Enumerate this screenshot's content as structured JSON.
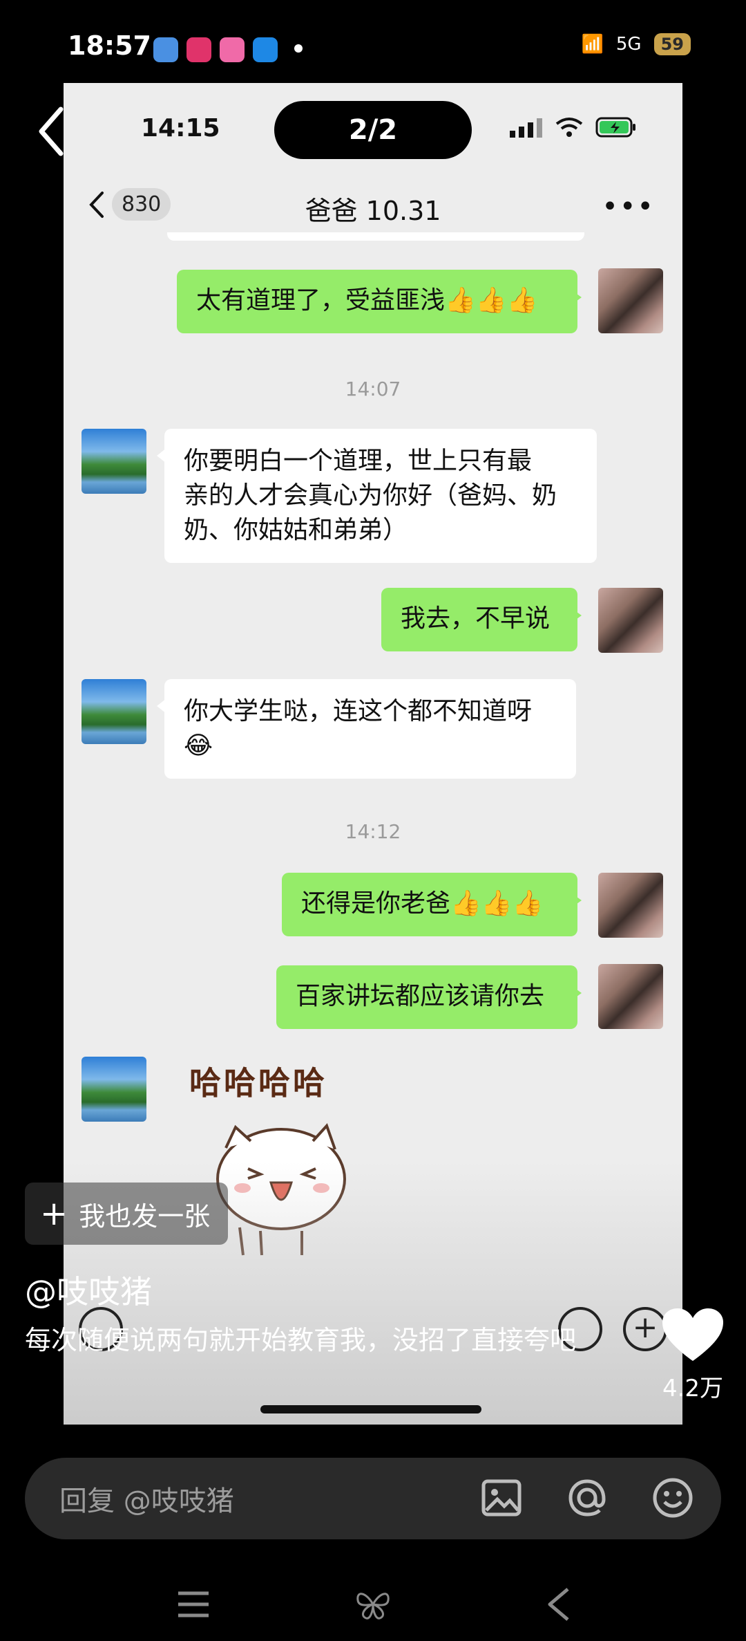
{
  "os_status": {
    "time": "18:57",
    "network": "5G",
    "battery": "59"
  },
  "screenshot": {
    "time": "14:15",
    "page_indicator": "2/2",
    "chat": {
      "back_count": "830",
      "title": "爸爸 10.31",
      "messages": [
        {
          "text": "太有道理了，受益匪浅👍👍👍"
        },
        {
          "timestamp": "14:07"
        },
        {
          "text_lines": [
            "你要明白一个道理，世上只有最",
            "亲的人才会真心为你好（爸妈、奶",
            "奶、你姑姑和弟弟）"
          ]
        },
        {
          "text": "我去，不早说"
        },
        {
          "text_lines": [
            "你大学生哒，连这个都不知道呀",
            "😂"
          ]
        },
        {
          "timestamp": "14:12"
        },
        {
          "text": "还得是你老爸👍👍👍"
        },
        {
          "text": "百家讲坛都应该请你去"
        },
        {
          "sticker_text": "哈哈哈哈"
        }
      ]
    }
  },
  "overlay": {
    "post_button": "我也发一张",
    "author": "@吱吱猪",
    "caption": "每次随便说两句就开始教育我，没招了直接夸吧",
    "like_count": "4.2万"
  },
  "reply": {
    "placeholder": "回复 @吱吱猪"
  },
  "icons": {
    "back": "chevron-left-icon",
    "image": "image-icon",
    "mention": "at-icon",
    "emoji": "emoji-icon",
    "like": "heart-icon"
  }
}
